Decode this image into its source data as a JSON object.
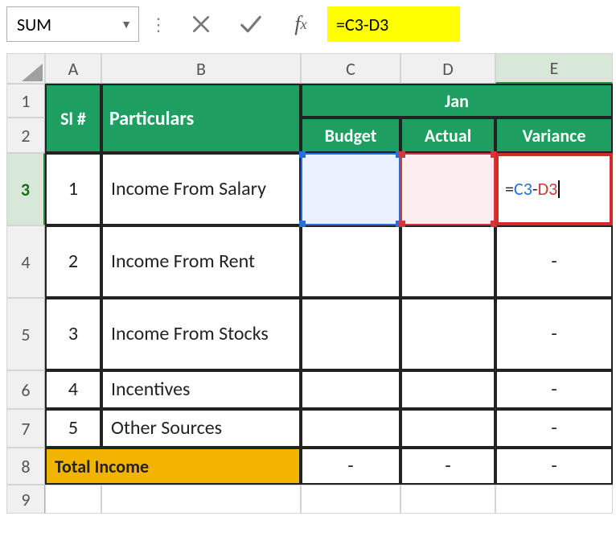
{
  "nameBox": "SUM",
  "formula": {
    "prefix": "=",
    "ref1": "C3",
    "op": "-",
    "ref2": "D3"
  },
  "columns": [
    "A",
    "B",
    "C",
    "D",
    "E"
  ],
  "rows": [
    "1",
    "2",
    "3",
    "4",
    "5",
    "6",
    "7",
    "8",
    "9"
  ],
  "activeColumn": "E",
  "activeRow": "3",
  "headers": {
    "sl": "Sl #",
    "particulars": "Particulars",
    "month": "Jan",
    "budget": "Budget",
    "actual": "Actual",
    "variance": "Variance"
  },
  "data": [
    {
      "sl": "1",
      "label": "Income From Salary",
      "budget": "",
      "actual": "",
      "variance": "=C3-D3"
    },
    {
      "sl": "2",
      "label": "Income From Rent",
      "budget": "",
      "actual": "",
      "variance": "-"
    },
    {
      "sl": "3",
      "label": "Income From Stocks",
      "budget": "",
      "actual": "",
      "variance": "-"
    },
    {
      "sl": "4",
      "label": "Incentives",
      "budget": "",
      "actual": "",
      "variance": "-"
    },
    {
      "sl": "5",
      "label": "Other Sources",
      "budget": "",
      "actual": "",
      "variance": "-"
    }
  ],
  "total": {
    "label": "Total Income",
    "budget": "-",
    "actual": "-",
    "variance": "-"
  },
  "chart_data": {
    "type": "table",
    "columns": [
      "Sl #",
      "Particulars",
      "Budget",
      "Actual",
      "Variance"
    ],
    "month": "Jan",
    "rows": [
      [
        "1",
        "Income From Salary",
        "",
        "",
        "=C3-D3"
      ],
      [
        "2",
        "Income From Rent",
        "",
        "",
        "-"
      ],
      [
        "3",
        "Income From Stocks",
        "",
        "",
        "-"
      ],
      [
        "4",
        "Incentives",
        "",
        "",
        "-"
      ],
      [
        "5",
        "Other Sources",
        "",
        "",
        "-"
      ],
      [
        "",
        "Total Income",
        "-",
        "-",
        "-"
      ]
    ]
  }
}
